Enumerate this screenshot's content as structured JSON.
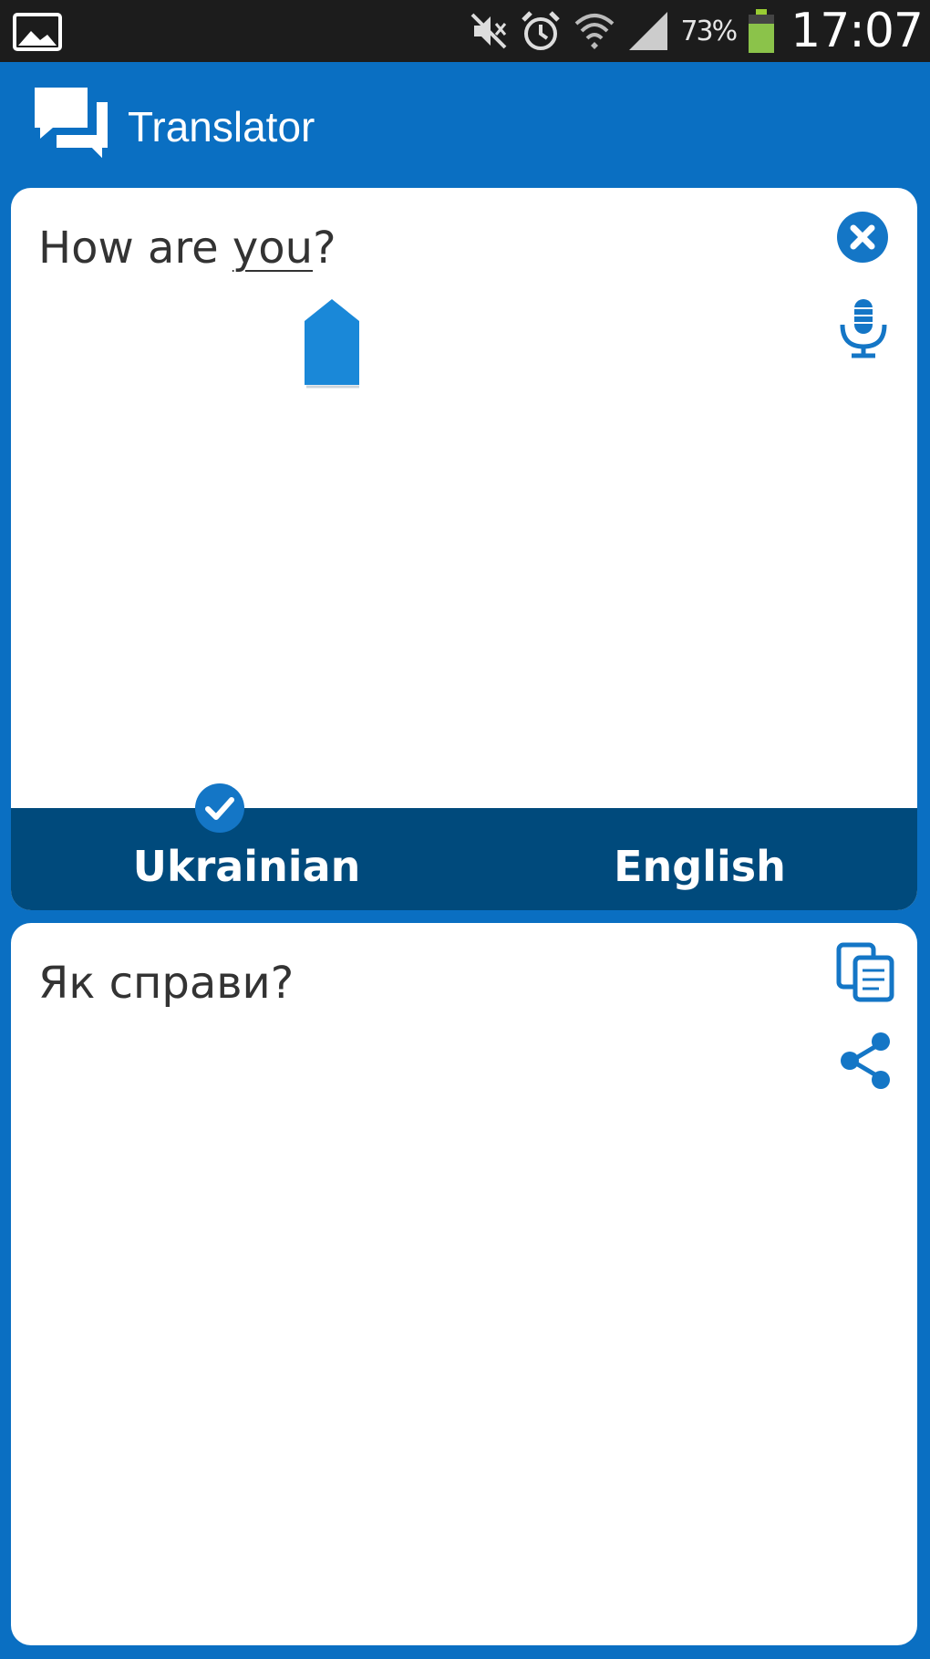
{
  "status_bar": {
    "battery_percent": "73%",
    "time": "17:07",
    "icons": [
      "gallery-icon",
      "mute-icon",
      "alarm-icon",
      "wifi-icon",
      "signal-icon",
      "battery-icon"
    ]
  },
  "app_bar": {
    "title": "Translator",
    "logo_icon": "chat-bubbles-icon"
  },
  "input": {
    "text_before": "How are ",
    "text_underlined": "you",
    "text_after": "?",
    "clear_icon": "close-circle-icon",
    "mic_icon": "microphone-icon"
  },
  "languages": {
    "source": "Ukrainian",
    "target": "English",
    "selected": "source"
  },
  "output": {
    "text": "Як справи?",
    "copy_icon": "copy-icon",
    "share_icon": "share-icon"
  },
  "colors": {
    "primary": "#0a6fc2",
    "lang_bar": "#004a7c",
    "status_bar": "#1c1c1c",
    "icon_blue": "#1476c6"
  }
}
